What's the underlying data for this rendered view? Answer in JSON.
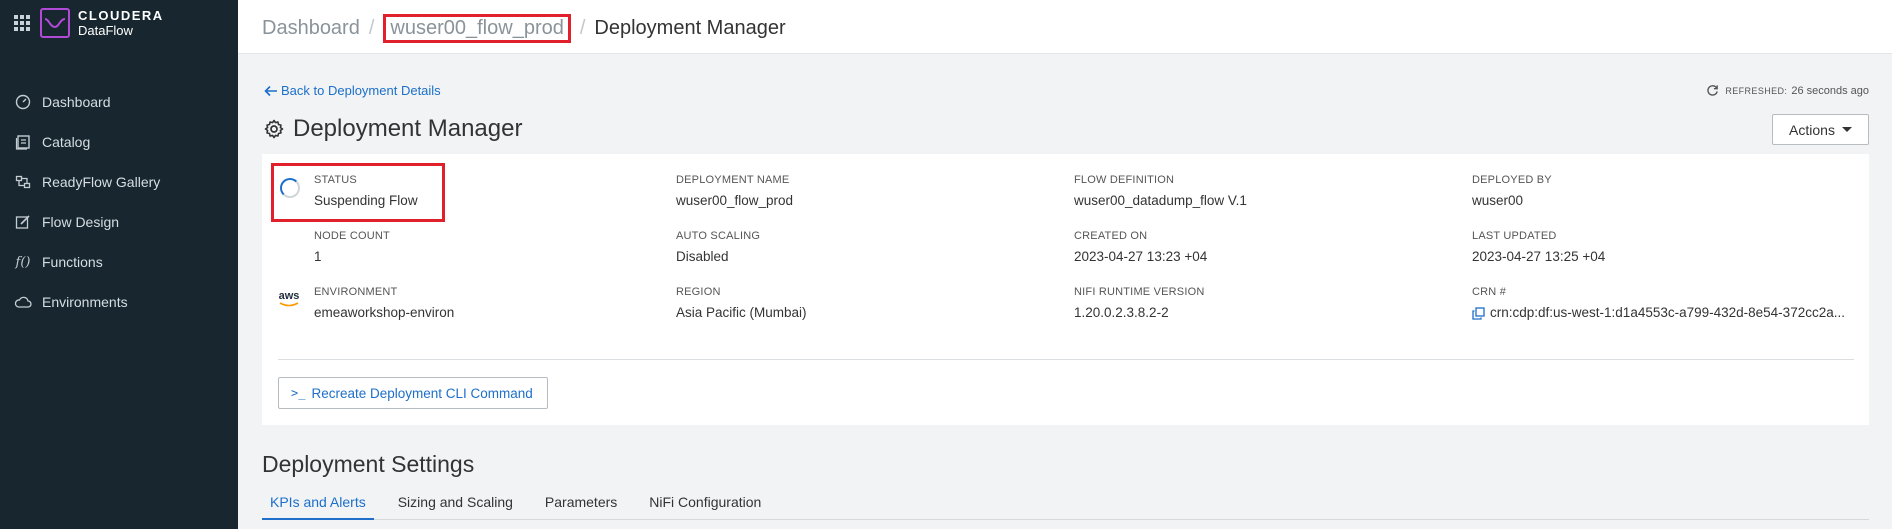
{
  "brand": {
    "line1": "CLOUDERA",
    "line2": "DataFlow",
    "accent": "#b04ad7"
  },
  "sidebar": {
    "items": [
      {
        "label": "Dashboard",
        "icon": "dashboard-gauge-icon"
      },
      {
        "label": "Catalog",
        "icon": "catalog-icon"
      },
      {
        "label": "ReadyFlow Gallery",
        "icon": "readyflow-icon"
      },
      {
        "label": "Flow Design",
        "icon": "flow-design-icon"
      },
      {
        "label": "Functions",
        "icon": "functions-icon"
      },
      {
        "label": "Environments",
        "icon": "cloud-icon"
      }
    ]
  },
  "breadcrumb": {
    "items": [
      "Dashboard",
      "wuser00_flow_prod",
      "Deployment Manager"
    ],
    "separator": "/"
  },
  "back_link": "Back to Deployment Details",
  "refreshed": {
    "label": "REFRESHED:",
    "value": "26 seconds ago"
  },
  "page_title": "Deployment Manager",
  "actions_label": "Actions",
  "details": {
    "status": {
      "label": "STATUS",
      "value": "Suspending Flow"
    },
    "deployment_name": {
      "label": "DEPLOYMENT NAME",
      "value": "wuser00_flow_prod"
    },
    "flow_definition": {
      "label": "FLOW DEFINITION",
      "value": "wuser00_datadump_flow V.1"
    },
    "deployed_by": {
      "label": "DEPLOYED BY",
      "value": "wuser00"
    },
    "node_count": {
      "label": "NODE COUNT",
      "value": "1"
    },
    "auto_scaling": {
      "label": "AUTO SCALING",
      "value": "Disabled"
    },
    "created_on": {
      "label": "CREATED ON",
      "value": "2023-04-27 13:23 +04"
    },
    "last_updated": {
      "label": "LAST UPDATED",
      "value": "2023-04-27 13:25 +04"
    },
    "environment": {
      "label": "ENVIRONMENT",
      "value": "emeaworkshop-environ"
    },
    "region": {
      "label": "REGION",
      "value": "Asia Pacific (Mumbai)"
    },
    "nifi_runtime": {
      "label": "NIFI RUNTIME VERSION",
      "value": "1.20.0.2.3.8.2-2"
    },
    "crn": {
      "label": "CRN #",
      "value": "crn:cdp:df:us-west-1:d1a4553c-a799-432d-8e54-372cc2a..."
    }
  },
  "aws_label": "aws",
  "cli_button": "Recreate Deployment CLI Command",
  "settings_title": "Deployment Settings",
  "tabs": [
    "KPIs and Alerts",
    "Sizing and Scaling",
    "Parameters",
    "NiFi Configuration"
  ],
  "colors": {
    "link": "#1d6fc9",
    "highlight": "#e0212b",
    "sidebar_bg": "#17262f"
  }
}
